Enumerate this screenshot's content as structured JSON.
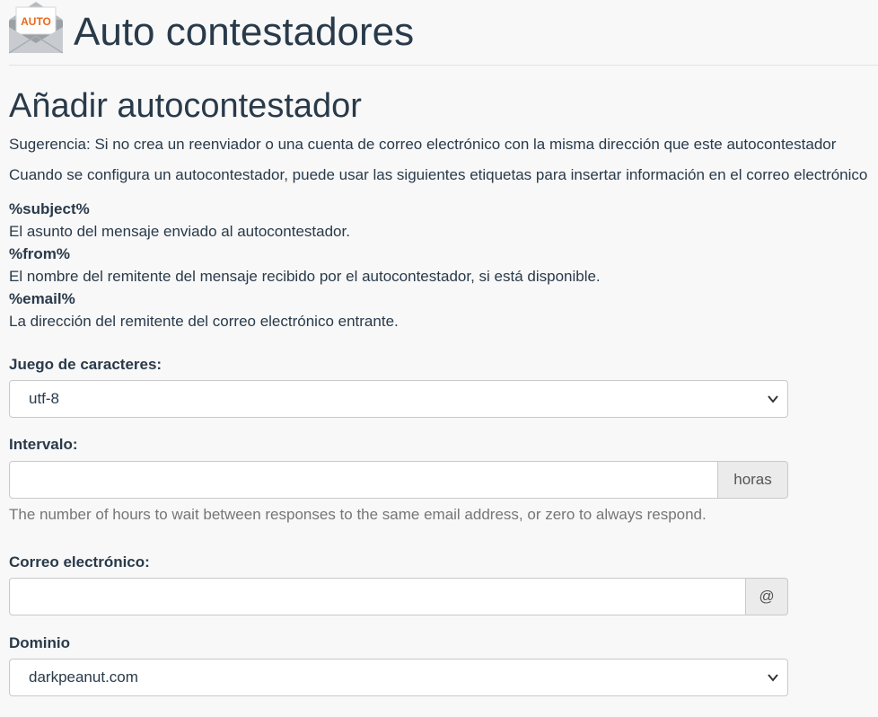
{
  "header": {
    "title": "Auto contestadores",
    "icon_badge": "AUTO",
    "icon_color": "#e86a1c"
  },
  "section": {
    "title": "Añadir autocontestador",
    "tip": "Sugerencia: Si no crea un reenviador o una cuenta de correo electrónico con la misma dirección que este autocontestador",
    "tags_intro": "Cuando se configura un autocontestador, puede usar las siguientes etiquetas para insertar información en el correo electrónico",
    "tags": [
      {
        "name": "%subject%",
        "desc": "El asunto del mensaje enviado al autocontestador."
      },
      {
        "name": "%from%",
        "desc": "El nombre del remitente del mensaje recibido por el autocontestador, si está disponible."
      },
      {
        "name": "%email%",
        "desc": "La dirección del remitente del correo electrónico entrante."
      }
    ]
  },
  "form": {
    "charset": {
      "label": "Juego de caracteres:",
      "value": "utf-8"
    },
    "interval": {
      "label": "Intervalo:",
      "value": "",
      "addon": "horas",
      "help": "The number of hours to wait between responses to the same email address, or zero to always respond."
    },
    "email": {
      "label": "Correo electrónico:",
      "value": "",
      "addon": "@"
    },
    "domain": {
      "label": "Dominio",
      "value": "darkpeanut.com"
    }
  }
}
